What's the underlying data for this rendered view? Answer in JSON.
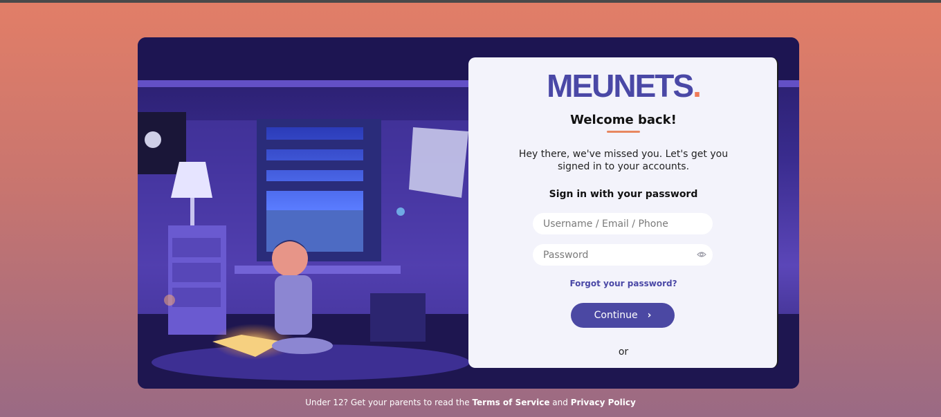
{
  "brand": {
    "name": "MEUNETS",
    "dot": ".",
    "accent": "#f07b57",
    "primary": "#4b48a3"
  },
  "login": {
    "title": "Welcome back!",
    "subtitle": "Hey there, we've missed you. Let's get you signed in to your accounts.",
    "signin_heading": "Sign in with your password",
    "username_placeholder": "Username / Email / Phone",
    "password_placeholder": "Password",
    "forgot_label": "Forgot your password?",
    "continue_label": "Continue",
    "continue_icon": "chevron-right-icon",
    "or_label": "or",
    "show_password_icon": "eye-icon"
  },
  "footer": {
    "prefix": "Under 12? Get your parents to read the",
    "terms_label": "Terms of Service",
    "joiner": "and",
    "privacy_label": "Privacy Policy"
  }
}
